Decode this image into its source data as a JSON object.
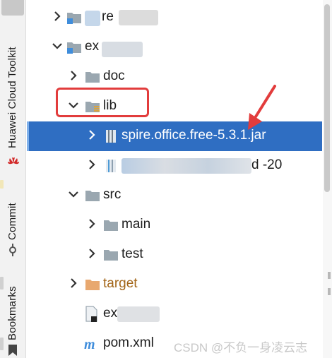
{
  "sidebar": {
    "tool_windows": [
      {
        "label": "Huawei Cloud Toolkit",
        "icon": "huawei-icon"
      },
      {
        "label": "Commit",
        "icon": "commit-icon"
      },
      {
        "label": "Bookmarks",
        "icon": "bookmark-icon"
      }
    ]
  },
  "tree": {
    "items": [
      {
        "label": "re",
        "icon": "module-folder-icon",
        "expanded": false
      },
      {
        "label": "ex",
        "icon": "module-folder-icon",
        "expanded": true
      },
      {
        "label": "doc",
        "icon": "folder-icon",
        "expanded": false
      },
      {
        "label": "lib",
        "icon": "library-folder-icon",
        "expanded": true
      },
      {
        "label": "spire.office.free-5.3.1.jar",
        "icon": "jar-icon",
        "expanded": false,
        "selected": true
      },
      {
        "label": "d -20",
        "icon": "jar-icon",
        "expanded": false
      },
      {
        "label": "src",
        "icon": "folder-icon",
        "expanded": true
      },
      {
        "label": "main",
        "icon": "folder-icon",
        "expanded": false
      },
      {
        "label": "test",
        "icon": "folder-icon",
        "expanded": false
      },
      {
        "label": "target",
        "icon": "excluded-folder-icon",
        "expanded": false
      },
      {
        "label": "ex .iml",
        "icon": "iml-file-icon"
      },
      {
        "label": "pom.xml",
        "icon": "maven-icon"
      }
    ]
  },
  "watermark": "CSDN @不负一身凌云志",
  "colors": {
    "selection": "#2f6ec2",
    "annotation": "#e23c3c",
    "folder": "#9aa7b0",
    "excluded_folder": "#e8a86f",
    "maven": "#3f8ddb"
  }
}
